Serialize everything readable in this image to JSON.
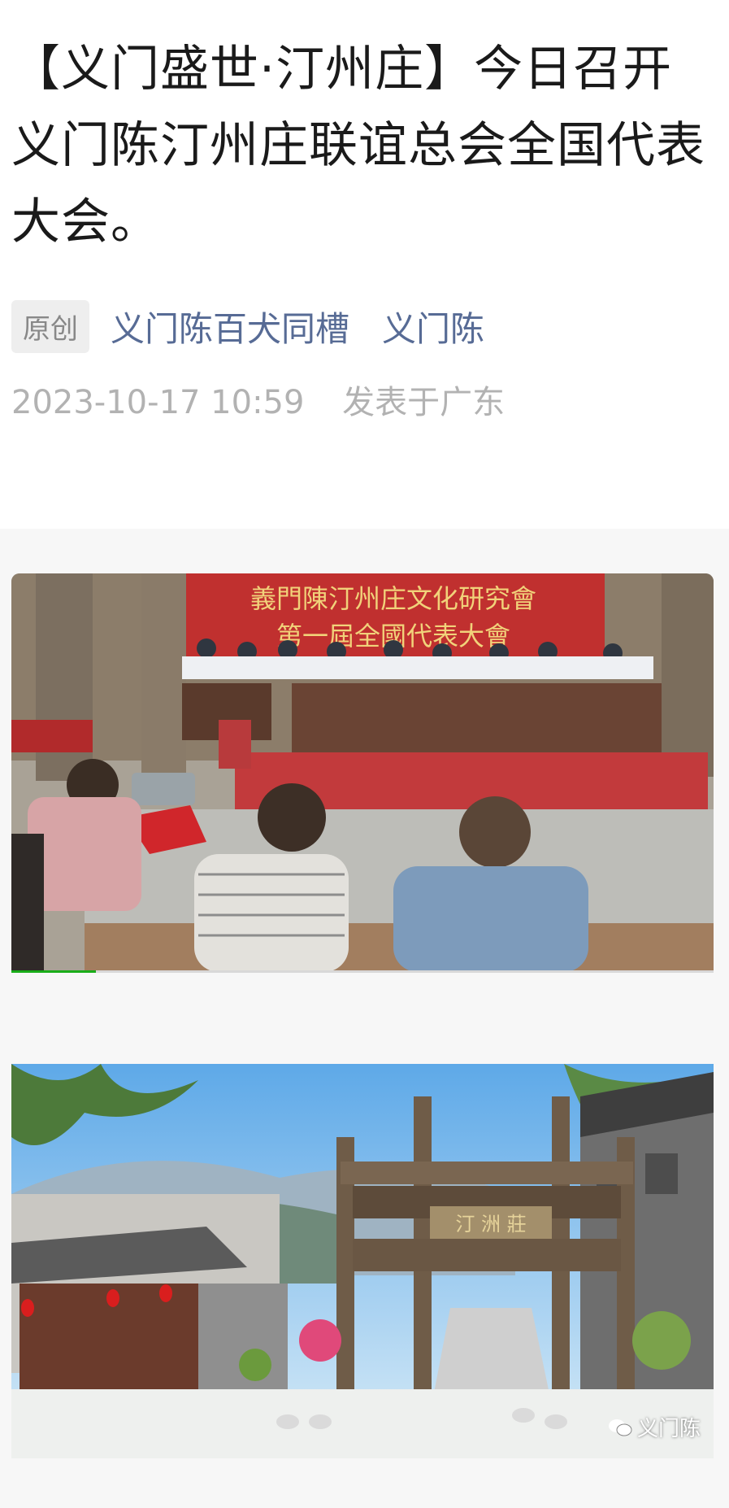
{
  "article": {
    "title": "【义门盛世·汀州庄】今日召开义门陈汀州庄联谊总会全国代表大会。",
    "badge": "原创",
    "author": "义门陈百犬同槽",
    "account": "义门陈",
    "datetime": "2023-10-17 10:59",
    "location": "发表于广东"
  },
  "photo1": {
    "banner_line1": "義門陳汀州庄文化研究會",
    "banner_line2": "第一屆全國代表大會",
    "progress": 0.12
  },
  "photo2": {
    "gate_plaque": "汀 洲 莊",
    "watermark": "义门陈"
  },
  "colors": {
    "link": "#576b95",
    "muted": "#b2b2b2",
    "progress": "#1aad19"
  }
}
